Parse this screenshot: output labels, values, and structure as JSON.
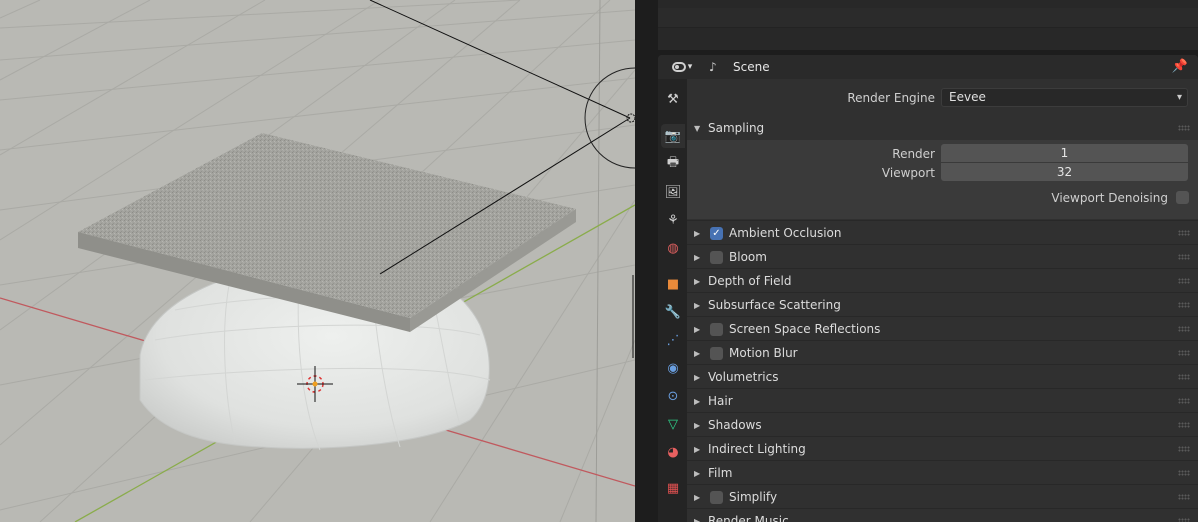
{
  "header": {
    "editor_type_icon": "properties-editor-icon",
    "scene_icon": "scene-icon",
    "title": "Scene",
    "pin_icon": "pin-icon"
  },
  "tabs": [
    {
      "name": "tool",
      "icon": "tool-icon",
      "glyph": "⚒",
      "color": "#cfcfcf"
    },
    {
      "name": "render",
      "icon": "render-icon",
      "glyph": "📷",
      "color": "#cfcfcf",
      "active": true
    },
    {
      "name": "output",
      "icon": "output-icon",
      "glyph": "🖶",
      "color": "#cfcfcf"
    },
    {
      "name": "view-layer",
      "icon": "view-layer-icon",
      "glyph": "🖼",
      "color": "#cfcfcf"
    },
    {
      "name": "scene",
      "icon": "scene-icon",
      "glyph": "⚘",
      "color": "#cfcfcf"
    },
    {
      "name": "world",
      "icon": "world-icon",
      "glyph": "◍",
      "color": "#e06060"
    },
    {
      "name": "object",
      "icon": "object-icon",
      "glyph": "■",
      "color": "#e98a3a"
    },
    {
      "name": "modifiers",
      "icon": "wrench-icon",
      "glyph": "🔧",
      "color": "#6a9fe0"
    },
    {
      "name": "particles",
      "icon": "particles-icon",
      "glyph": "⋰",
      "color": "#6a9fe0"
    },
    {
      "name": "physics",
      "icon": "physics-icon",
      "glyph": "◉",
      "color": "#6a9fe0"
    },
    {
      "name": "constraints",
      "icon": "constraints-icon",
      "glyph": "⊙",
      "color": "#6a9fe0"
    },
    {
      "name": "data",
      "icon": "mesh-data-icon",
      "glyph": "▽",
      "color": "#2fd28a"
    },
    {
      "name": "material",
      "icon": "material-icon",
      "glyph": "◕",
      "color": "#e86060"
    },
    {
      "name": "texture",
      "icon": "texture-icon",
      "glyph": "▦",
      "color": "#e05050"
    }
  ],
  "render_engine": {
    "label": "Render Engine",
    "value": "Eevee"
  },
  "sampling": {
    "title": "Sampling",
    "render_label": "Render",
    "render_value": "1",
    "viewport_label": "Viewport",
    "viewport_value": "32",
    "denoise_label": "Viewport Denoising",
    "denoise_checked": false
  },
  "panels": [
    {
      "title": "Ambient Occlusion",
      "checkbox": true,
      "checked": true
    },
    {
      "title": "Bloom",
      "checkbox": true,
      "checked": false
    },
    {
      "title": "Depth of Field",
      "checkbox": false
    },
    {
      "title": "Subsurface Scattering",
      "checkbox": false
    },
    {
      "title": "Screen Space Reflections",
      "checkbox": true,
      "checked": false
    },
    {
      "title": "Motion Blur",
      "checkbox": true,
      "checked": false
    },
    {
      "title": "Volumetrics",
      "checkbox": false
    },
    {
      "title": "Hair",
      "checkbox": false
    },
    {
      "title": "Shadows",
      "checkbox": false
    },
    {
      "title": "Indirect Lighting",
      "checkbox": false
    },
    {
      "title": "Film",
      "checkbox": false
    },
    {
      "title": "Simplify",
      "checkbox": true,
      "checked": false
    },
    {
      "title": "Render Music",
      "checkbox": false
    }
  ],
  "colors": {
    "accent": "#4772b3",
    "viewport_bg": "#b9b9b4",
    "x_axis": "#c0595e",
    "y_axis": "#8aac4b"
  }
}
